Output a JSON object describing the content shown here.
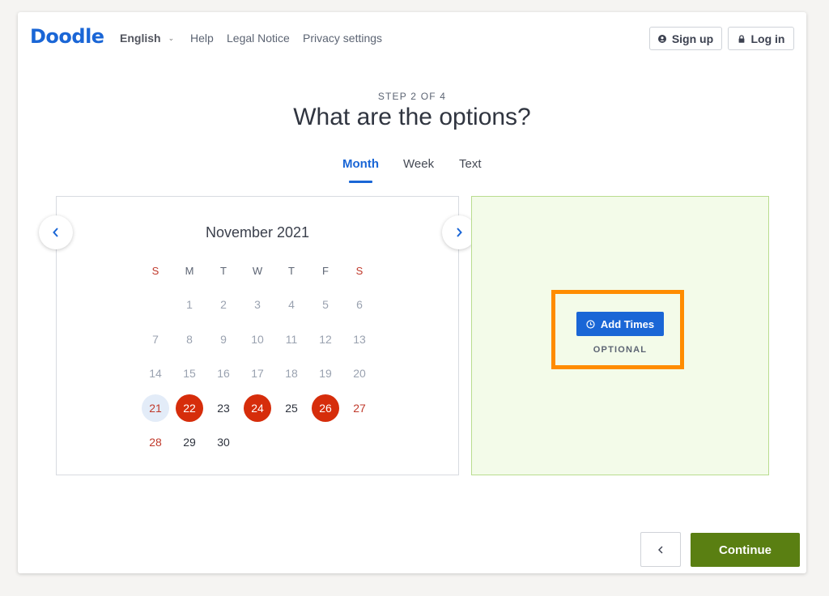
{
  "header": {
    "logo": "Doodle",
    "language": "English",
    "links": [
      "Help",
      "Legal Notice",
      "Privacy settings"
    ],
    "signup_label": "Sign up",
    "login_label": "Log in"
  },
  "step_label": "STEP 2 OF 4",
  "page_title": "What are the options?",
  "tabs": [
    "Month",
    "Week",
    "Text"
  ],
  "active_tab": "Month",
  "calendar": {
    "month_label": "November 2021",
    "weekdays": [
      "S",
      "M",
      "T",
      "W",
      "T",
      "F",
      "S"
    ],
    "weeks": [
      [
        "",
        "1",
        "2",
        "3",
        "4",
        "5",
        "6"
      ],
      [
        "7",
        "8",
        "9",
        "10",
        "11",
        "12",
        "13"
      ],
      [
        "14",
        "15",
        "16",
        "17",
        "18",
        "19",
        "20"
      ],
      [
        "21",
        "22",
        "23",
        "24",
        "25",
        "26",
        "27"
      ],
      [
        "28",
        "29",
        "30",
        "",
        "",
        "",
        ""
      ]
    ],
    "today": "21",
    "selected_days": [
      "22",
      "24",
      "26"
    ]
  },
  "times_panel": {
    "add_times_label": "Add Times",
    "optional_label": "OPTIONAL"
  },
  "footer": {
    "continue_label": "Continue"
  },
  "colors": {
    "brand_blue": "#1a66d6",
    "selected_red": "#d62d0b",
    "continue_green": "#5a7f12",
    "highlight_orange": "#ff8c00"
  }
}
